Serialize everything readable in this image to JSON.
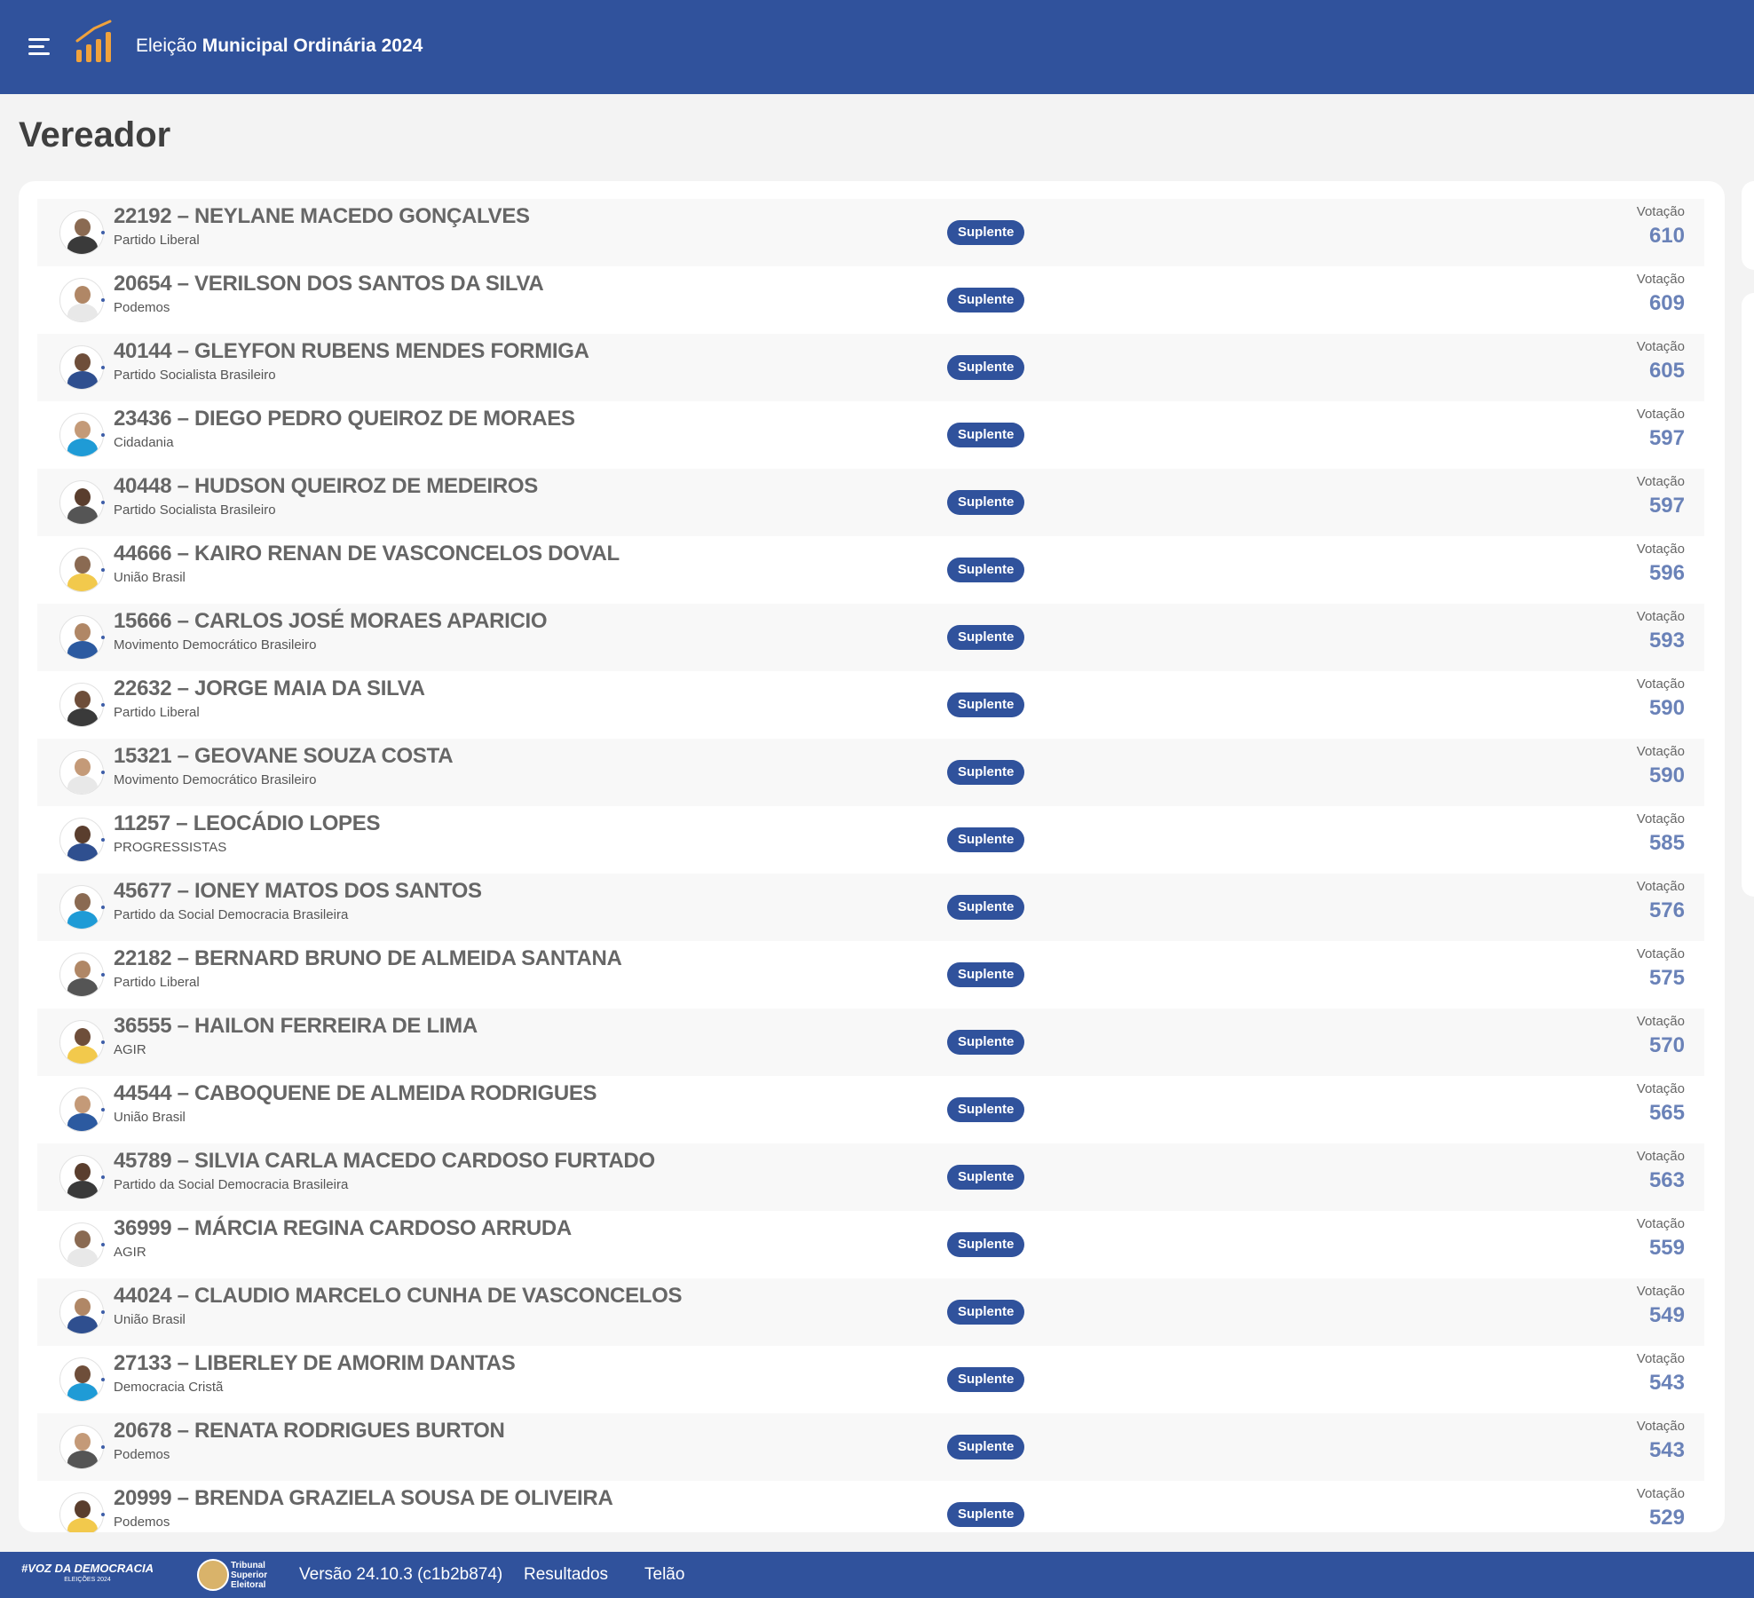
{
  "header": {
    "title_prefix": "Eleição",
    "title_bold": "Municipal Ordinária 2024",
    "accent": "#30529c",
    "logo_color": "#f0a23c"
  },
  "page": {
    "title": "Vereador"
  },
  "candidates": [
    {
      "label": "22192 – NEYLANE MACEDO GONÇALVES",
      "party": "Partido Liberal",
      "status": "Suplente",
      "votes_label": "Votação",
      "votes": "610"
    },
    {
      "label": "20654 – VERILSON DOS SANTOS DA SILVA",
      "party": "Podemos",
      "status": "Suplente",
      "votes_label": "Votação",
      "votes": "609"
    },
    {
      "label": "40144 – GLEYFON RUBENS MENDES FORMIGA",
      "party": "Partido Socialista Brasileiro",
      "status": "Suplente",
      "votes_label": "Votação",
      "votes": "605"
    },
    {
      "label": "23436 – DIEGO PEDRO QUEIROZ DE MORAES",
      "party": "Cidadania",
      "status": "Suplente",
      "votes_label": "Votação",
      "votes": "597"
    },
    {
      "label": "40448 – HUDSON QUEIROZ DE MEDEIROS",
      "party": "Partido Socialista Brasileiro",
      "status": "Suplente",
      "votes_label": "Votação",
      "votes": "597"
    },
    {
      "label": "44666 – KAIRO RENAN DE VASCONCELOS DOVAL",
      "party": "União Brasil",
      "status": "Suplente",
      "votes_label": "Votação",
      "votes": "596"
    },
    {
      "label": "15666 – CARLOS JOSÉ MORAES APARICIO",
      "party": "Movimento Democrático Brasileiro",
      "status": "Suplente",
      "votes_label": "Votação",
      "votes": "593"
    },
    {
      "label": "22632 – JORGE MAIA DA SILVA",
      "party": "Partido Liberal",
      "status": "Suplente",
      "votes_label": "Votação",
      "votes": "590"
    },
    {
      "label": "15321 – GEOVANE SOUZA COSTA",
      "party": "Movimento Democrático Brasileiro",
      "status": "Suplente",
      "votes_label": "Votação",
      "votes": "590"
    },
    {
      "label": "11257 – LEOCÁDIO LOPES",
      "party": "PROGRESSISTAS",
      "status": "Suplente",
      "votes_label": "Votação",
      "votes": "585"
    },
    {
      "label": "45677 – IONEY MATOS DOS SANTOS",
      "party": "Partido da Social Democracia Brasileira",
      "status": "Suplente",
      "votes_label": "Votação",
      "votes": "576"
    },
    {
      "label": "22182 – BERNARD BRUNO DE ALMEIDA SANTANA",
      "party": "Partido Liberal",
      "status": "Suplente",
      "votes_label": "Votação",
      "votes": "575"
    },
    {
      "label": "36555 – HAILON FERREIRA DE LIMA",
      "party": "AGIR",
      "status": "Suplente",
      "votes_label": "Votação",
      "votes": "570"
    },
    {
      "label": "44544 – CABOQUENE DE ALMEIDA RODRIGUES",
      "party": "União Brasil",
      "status": "Suplente",
      "votes_label": "Votação",
      "votes": "565"
    },
    {
      "label": "45789 – SILVIA CARLA MACEDO CARDOSO FURTADO",
      "party": "Partido da Social Democracia Brasileira",
      "status": "Suplente",
      "votes_label": "Votação",
      "votes": "563"
    },
    {
      "label": "36999 – MÁRCIA REGINA CARDOSO ARRUDA",
      "party": "AGIR",
      "status": "Suplente",
      "votes_label": "Votação",
      "votes": "559"
    },
    {
      "label": "44024 – CLAUDIO MARCELO CUNHA DE VASCONCELOS",
      "party": "União Brasil",
      "status": "Suplente",
      "votes_label": "Votação",
      "votes": "549"
    },
    {
      "label": "27133 – LIBERLEY DE AMORIM DANTAS",
      "party": "Democracia Cristã",
      "status": "Suplente",
      "votes_label": "Votação",
      "votes": "543"
    },
    {
      "label": "20678 – RENATA RODRIGUES BURTON",
      "party": "Podemos",
      "status": "Suplente",
      "votes_label": "Votação",
      "votes": "543"
    },
    {
      "label": "20999 – BRENDA GRAZIELA SOUSA DE OLIVEIRA",
      "party": "Podemos",
      "status": "Suplente",
      "votes_label": "Votação",
      "votes": "529"
    }
  ],
  "footer": {
    "brand_logo_text": "#VOZ DA DEMOCRACIA",
    "brand_logo_sub": "ELEIÇÕES 2024",
    "tse_line1": "Tribunal",
    "tse_line2": "Superior",
    "tse_line3": "Eleitoral",
    "version": "Versão 24.10.3 (c1b2b874)",
    "link_results": "Resultados",
    "link_telao": "Telão"
  }
}
